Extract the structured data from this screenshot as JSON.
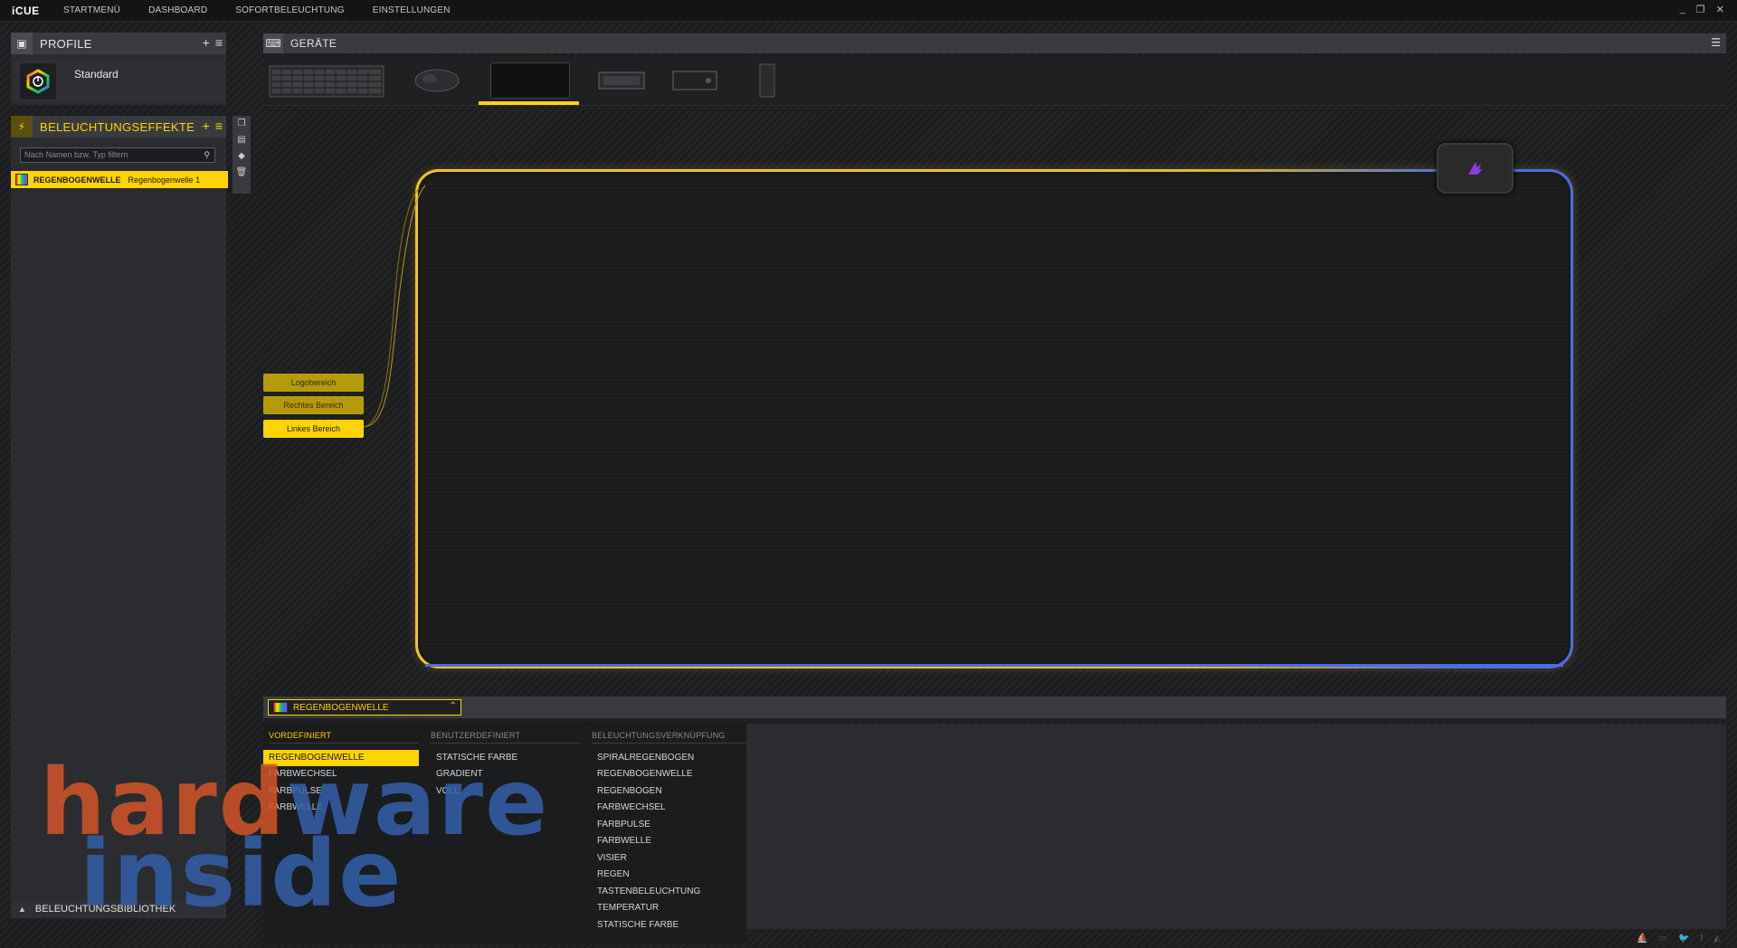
{
  "app": {
    "brand": "iCUE",
    "nav": [
      "STARTMENÜ",
      "DASHBOARD",
      "SOFORTBELEUCHTUNG",
      "EINSTELLUNGEN"
    ],
    "window_controls": [
      "_",
      "❐",
      "✕"
    ]
  },
  "profiles": {
    "title": "PROFILE",
    "add": "+",
    "menu": "≡",
    "items": [
      {
        "name": "Standard"
      }
    ]
  },
  "effects": {
    "title": "BELEUCHTUNGSEFFEKTE",
    "add": "+",
    "menu": "≡",
    "search_placeholder": "Nach Namen bzw. Typ filtern",
    "items": [
      {
        "type": "REGENBOGENWELLE",
        "name": "Regenbogenwelle 1"
      }
    ]
  },
  "library": {
    "label": "BELEUCHTUNGSBIBLIOTHEK"
  },
  "devices": {
    "title": "GERÄTE",
    "icons": [
      "keyboard-icon",
      "mouse-icon",
      "mousepad-icon",
      "gpu-icon",
      "controller-icon",
      "headset-stand-icon"
    ],
    "selected_index": 2
  },
  "zones": [
    {
      "label": "Logobereich",
      "active": false
    },
    {
      "label": "Rechtes Bereich",
      "active": false
    },
    {
      "label": "Linkes Bereich",
      "active": true
    }
  ],
  "effect_select": {
    "value": "REGENBOGENWELLE"
  },
  "effect_menu": {
    "columns": [
      {
        "header": "VORDEFINIERT",
        "items": [
          "REGENBOGENWELLE",
          "FARBWECHSEL",
          "FARBPULSE",
          "FARBWELLE"
        ],
        "selected": 0
      },
      {
        "header": "BENUTZERDEFINIERT",
        "items": [
          "STATISCHE FARBE",
          "GRADIENT",
          "VOLL"
        ]
      },
      {
        "header": "BELEUCHTUNGSVERKNÜPFUNG",
        "items": [
          "SPIRALREGENBOGEN",
          "REGENBOGENWELLE",
          "REGENBOGEN",
          "FARBWECHSEL",
          "FARBPULSE",
          "FARBWELLE",
          "VISIER",
          "REGEN",
          "TASTENBELEUCHTUNG",
          "TEMPERATUR",
          "STATISCHE FARBE"
        ]
      }
    ]
  },
  "watermark": {
    "line1a": "hard",
    "line1b": "ware",
    "line2": "inside"
  },
  "colors": {
    "accent": "#ffd400",
    "pad_left": "#f3c527",
    "pad_right": "#4a6de6"
  }
}
